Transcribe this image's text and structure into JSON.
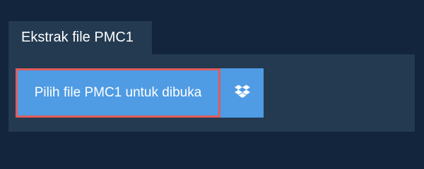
{
  "tab": {
    "label": "Ekstrak file PMC1"
  },
  "actions": {
    "pick_file_label": "Pilih file PMC1 untuk dibuka",
    "dropbox_icon": "dropbox-icon"
  },
  "colors": {
    "background": "#12253c",
    "panel": "#233a51",
    "button": "#4f9be4",
    "highlight_border": "#e15c5a",
    "text": "#ffffff"
  }
}
